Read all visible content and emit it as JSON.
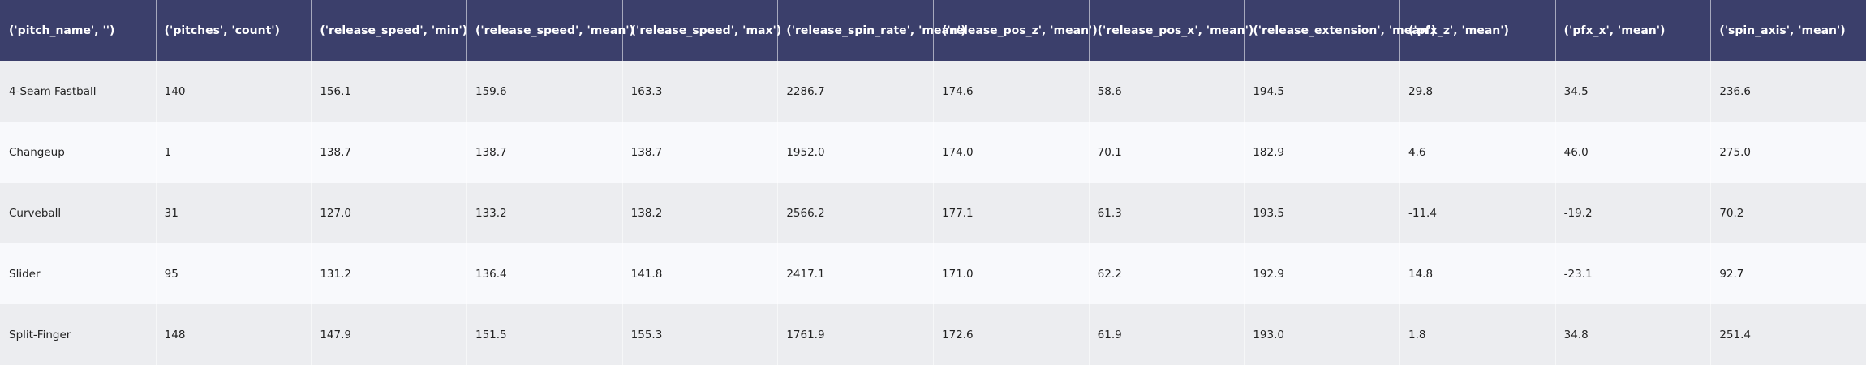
{
  "chart_data": {
    "type": "table",
    "columns": [
      "('pitch_name', '')",
      "('pitches', 'count')",
      "('release_speed', 'min')",
      "('release_speed', 'mean')",
      "('release_speed', 'max')",
      "('release_spin_rate', 'mean')",
      "('release_pos_z', 'mean')",
      "('release_pos_x', 'mean')",
      "('release_extension', 'mean')",
      "('pfx_z', 'mean')",
      "('pfx_x', 'mean')",
      "('spin_axis', 'mean')"
    ],
    "rows": [
      [
        "4-Seam Fastball",
        "140",
        "156.1",
        "159.6",
        "163.3",
        "2286.7",
        "174.6",
        "58.6",
        "194.5",
        "29.8",
        "34.5",
        "236.6"
      ],
      [
        "Changeup",
        "1",
        "138.7",
        "138.7",
        "138.7",
        "1952.0",
        "174.0",
        "70.1",
        "182.9",
        "4.6",
        "46.0",
        "275.0"
      ],
      [
        "Curveball",
        "31",
        "127.0",
        "133.2",
        "138.2",
        "2566.2",
        "177.1",
        "61.3",
        "193.5",
        "-11.4",
        "-19.2",
        "70.2"
      ],
      [
        "Slider",
        "95",
        "131.2",
        "136.4",
        "141.8",
        "2417.1",
        "171.0",
        "62.2",
        "192.9",
        "14.8",
        "-23.1",
        "92.7"
      ],
      [
        "Split-Finger",
        "148",
        "147.9",
        "151.5",
        "155.3",
        "1761.9",
        "172.6",
        "61.9",
        "193.0",
        "1.8",
        "34.8",
        "251.4"
      ]
    ],
    "colors": {
      "header_bg": "#3b3f6b",
      "header_text": "#ffffff",
      "row_odd": "#ecedf0",
      "row_even": "#f8f9fc"
    }
  }
}
